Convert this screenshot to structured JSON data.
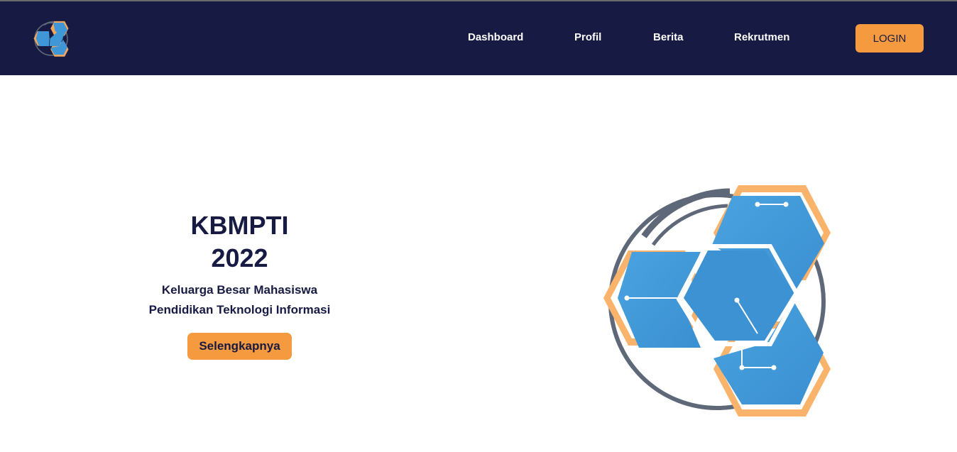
{
  "nav": {
    "items": [
      {
        "label": "Dashboard"
      },
      {
        "label": "Profil"
      },
      {
        "label": "Berita"
      },
      {
        "label": "Rekrutmen"
      }
    ],
    "login_label": "LOGIN"
  },
  "hero": {
    "title_line1": "KBMPTI",
    "title_line2": "2022",
    "subtitle_line1": "Keluarga Besar Mahasiswa",
    "subtitle_line2": "Pendidikan Teknologi Informasi",
    "cta_label": "Selengkapnya"
  },
  "colors": {
    "navbar": "#171a42",
    "accent": "#f59a3e",
    "logo_blue": "#3f97d8",
    "ring": "#5e6878"
  },
  "icons": {
    "small_logo": "kbmpti-logo-icon",
    "hero_logo": "kbmpti-emblem"
  }
}
